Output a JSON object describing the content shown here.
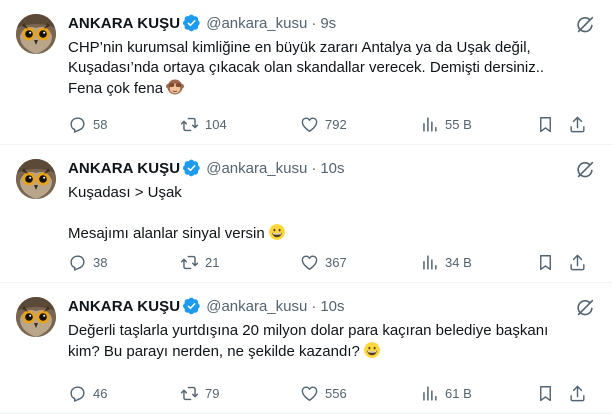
{
  "tweets": [
    {
      "name": "ANKARA KUŞU",
      "handle": "@ankara_kusu",
      "separator": "·",
      "time": "9s",
      "lines": [
        "CHP’nin kurumsal kimliğine en büyük zararı Antalya ya da Uşak değil,",
        "Kuşadası’nda ortaya çıkacak olan skandallar verecek. Demişti dersiniz..",
        "Fena çok fena"
      ],
      "emoji": "see-no-evil-monkey",
      "replies": "58",
      "reposts": "104",
      "likes": "792",
      "views": "55 B"
    },
    {
      "name": "ANKARA KUŞU",
      "handle": "@ankara_kusu",
      "separator": "·",
      "time": "10s",
      "lines": [
        "Kuşadası > Uşak",
        "Mesajımı alanlar sinyal versin"
      ],
      "emoji": "grinning-face",
      "replies": "38",
      "reposts": "21",
      "likes": "367",
      "views": "34 B"
    },
    {
      "name": "ANKARA KUŞU",
      "handle": "@ankara_kusu",
      "separator": "·",
      "time": "10s",
      "lines": [
        "Değerli taşlarla yurtdışına 20 milyon dolar para kaçıran belediye başkanı",
        "kim? Bu parayı nerden, ne şekilde kazandı?"
      ],
      "emoji": "grinning-face",
      "replies": "46",
      "reposts": "79",
      "likes": "556",
      "views": "61 B"
    }
  ],
  "colors": {
    "text": "#0f1419",
    "secondary": "#536471",
    "verified": "#1d9bf0",
    "divider": "#eff3f4"
  }
}
